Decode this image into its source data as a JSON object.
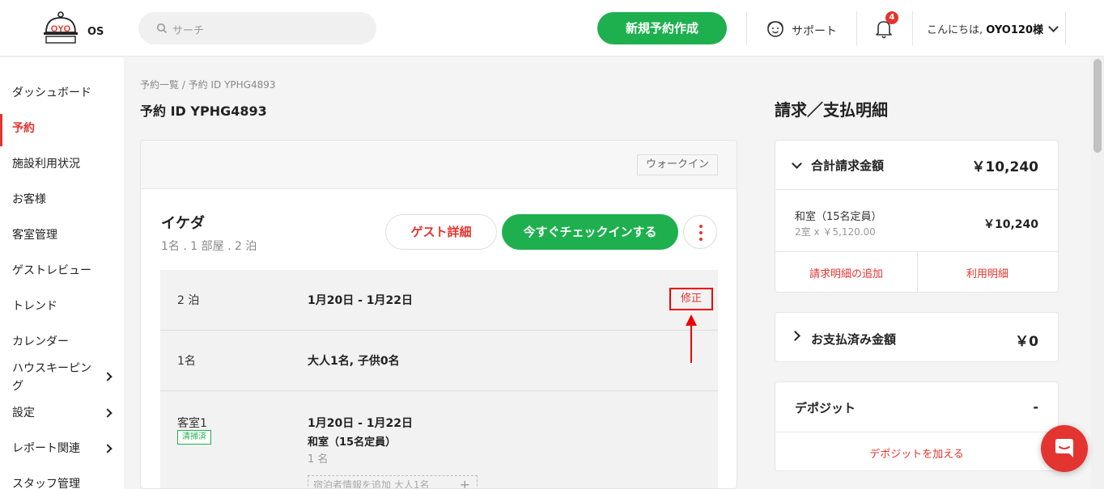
{
  "header": {
    "logo_text": "OS",
    "search_placeholder": "サーチ",
    "new_booking": "新規予約作成",
    "support": "サポート",
    "notification_count": "4",
    "greeting_prefix": "こんにちは, ",
    "greeting_user": "OYO120様"
  },
  "sidebar": {
    "items": [
      {
        "label": "ダッシュボード"
      },
      {
        "label": "予約"
      },
      {
        "label": "施設利用状況"
      },
      {
        "label": "お客様"
      },
      {
        "label": "客室管理"
      },
      {
        "label": "ゲストレビュー"
      },
      {
        "label": "トレンド"
      },
      {
        "label": "カレンダー"
      },
      {
        "label": "ハウスキーピング"
      },
      {
        "label": "設定"
      },
      {
        "label": "レポート関連"
      },
      {
        "label": "スタッフ管理"
      }
    ]
  },
  "main": {
    "breadcrumb": "予約一覧 / 予約 ID YPHG4893",
    "title": "予約 ID YPHG4893",
    "source_tag": "ウォークイン",
    "guest_name": "イケダ",
    "guest_summary": "1名 . 1 部屋 . 2 泊",
    "guest_detail_btn": "ゲスト詳細",
    "checkin_btn": "今すぐチェックインする",
    "nights_label": "2 泊",
    "nights_value": "1月20日 - 1月22日",
    "edit_label": "修正",
    "guests_label": "1名",
    "guests_value": "大人1名, 子供0名",
    "room_label": "客室1",
    "room_status": "清掃済",
    "room_dates": "1月20日 - 1月22日",
    "room_type": "和室（15名定員）",
    "room_guests": "1 名",
    "add_guest_info": "宿泊者情報を追加 大人1名"
  },
  "billing": {
    "title": "請求／支払明細",
    "total_label": "合計請求金額",
    "total_amount": "￥10,240",
    "line_name": "和室（15名定員）",
    "line_detail": "2室 x ￥5,120.00",
    "line_amount": "￥10,240",
    "add_charge": "請求明細の追加",
    "usage": "利用明細",
    "paid_label": "お支払済み金額",
    "paid_amount": "￥0",
    "deposit_label": "デポジット",
    "deposit_value": "-",
    "add_deposit": "デポジットを加える"
  },
  "colors": {
    "brand_red": "#e4342f",
    "accent_green": "#1eb04e"
  }
}
